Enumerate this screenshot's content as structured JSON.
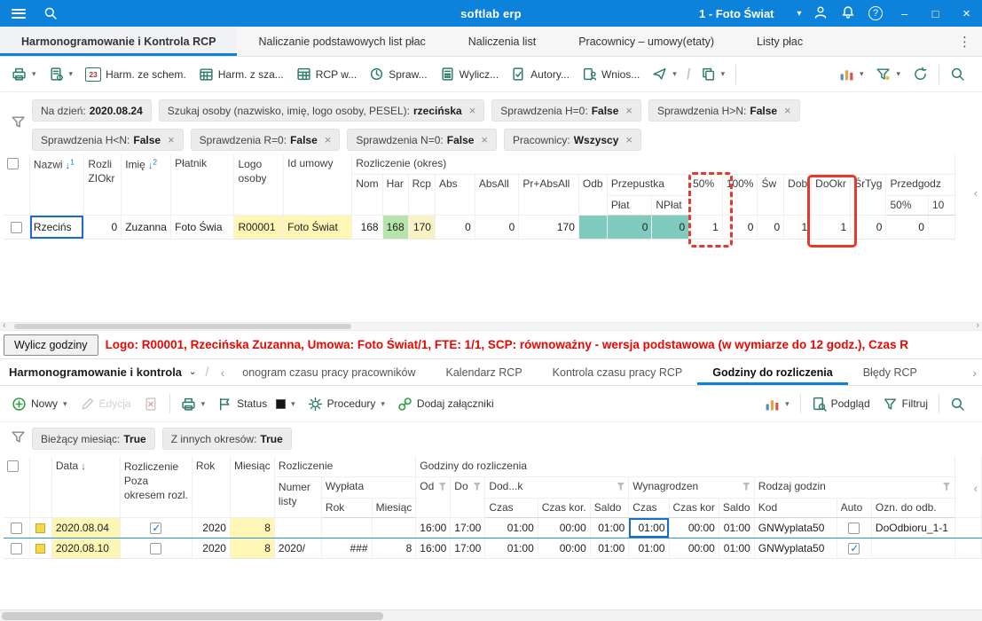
{
  "titlebar": {
    "app": "softlab erp",
    "company": "1 - Foto Świat"
  },
  "tabs": [
    {
      "label": "Harmonogramowanie i Kontrola RCP"
    },
    {
      "label": "Naliczanie podstawowych list płac"
    },
    {
      "label": "Naliczenia list"
    },
    {
      "label": "Pracownicy – umowy(etaty)"
    },
    {
      "label": "Listy płac"
    }
  ],
  "toolbar1": {
    "harm_ze_schem": "Harm. ze schem.",
    "harm_z_sza": "Harm. z sza...",
    "rcp_w": "RCP w...",
    "spraw": "Spraw...",
    "wylicz": "Wylicz...",
    "autory": "Autory...",
    "wnios": "Wnios..."
  },
  "filters1": [
    {
      "label": "Na dzień:",
      "value": "2020.08.24"
    },
    {
      "label": "Szukaj osoby (nazwisko, imię, logo osoby, PESEL):",
      "value": "rzecińska"
    },
    {
      "label": "Sprawdzenia  H=0:",
      "value": "False"
    },
    {
      "label": "Sprawdzenia  H>N:",
      "value": "False"
    },
    {
      "label": "Sprawdzenia  H<N:",
      "value": "False"
    },
    {
      "label": "Sprawdzenia  R=0:",
      "value": "False"
    },
    {
      "label": "Sprawdzenia  N=0:",
      "value": "False"
    },
    {
      "label": "Pracownicy:",
      "value": "Wszyscy"
    }
  ],
  "grid1": {
    "header": {
      "nazwisko": "Nazwi",
      "nazwisko_sort": "1",
      "rozli1": "Rozli",
      "rozli2": "ZIOkr",
      "imie": "Imię",
      "imie_sort": "2",
      "platnik": "Płatnik",
      "logo1": "Logo",
      "logo2": "osoby",
      "id_umowy": "Id umowy",
      "group": "Rozliczenie (okres)",
      "nom": "Nom",
      "har": "Har",
      "rcp": "Rcp",
      "abs": "Abs",
      "absall": "AbsAll",
      "prabsall": "Pr+AbsAll",
      "odb": "Odb",
      "przepustka": "Przepustka",
      "plat": "Płat",
      "nplat": "NPłat",
      "p50": "50%",
      "p100": "100%",
      "sw": "Św",
      "dob": "Dob",
      "dookr": "DoOkr",
      "srtyg": "ŚrTyg",
      "przedgodz": "Przedgodz",
      "pg50": "50%",
      "pg100": "10"
    },
    "row": {
      "nazwisko": "Rzecińs",
      "rozli": "0",
      "imie": "Zuzanna",
      "platnik": "Foto Świa",
      "logo": "R00001",
      "id_umowy": "Foto Świat",
      "nom": "168",
      "har": "168",
      "rcp": "170",
      "abs": "0",
      "absall": "0",
      "prabsall": "170",
      "odb": "",
      "plat": "0",
      "nplat": "0",
      "p50": "1",
      "p100": "0",
      "sw": "0",
      "dob": "1",
      "dookr": "1",
      "srtyg": "0",
      "pg50": "0",
      "pg100": ""
    }
  },
  "footer1": {
    "button": "Wylicz godziny",
    "info": "Logo: R00001, Rzecińska Zuzanna, Umowa: Foto Świat/1, FTE: 1/1, SCP: równoważny - wersja podstawowa (w wymiarze do 12 godz.), Czas R"
  },
  "section2": {
    "title": "Harmonogramowanie i kontrola",
    "tabs": [
      {
        "label": "onogram czasu pracy pracowników"
      },
      {
        "label": "Kalendarz RCP"
      },
      {
        "label": "Kontrola czasu pracy RCP"
      },
      {
        "label": "Godziny do rozliczenia"
      },
      {
        "label": "Błędy RCP"
      }
    ]
  },
  "toolbar2": {
    "nowy": "Nowy",
    "edycja": "Edycja",
    "status": "Status",
    "procedury": "Procedury",
    "zalaczniki": "Dodaj załączniki",
    "podglad": "Podgląd",
    "filtruj": "Filtruj"
  },
  "filters2": [
    {
      "label": "Bieżący miesiąc:",
      "value": "True"
    },
    {
      "label": "Z innych okresów:",
      "value": "True"
    }
  ],
  "grid2": {
    "header": {
      "data": "Data",
      "rozliczenie1": "Rozliczenie",
      "rozliczenie2": "Poza",
      "rozliczenie3": "okresem rozl.",
      "rok": "Rok",
      "miesiac": "Miesiąc",
      "rozliczenie_grp": "Rozliczenie",
      "godziny_grp": "Godziny do rozliczenia",
      "numer1": "Numer",
      "numer2": "listy",
      "wyplata": "Wypłata",
      "wyp_rok": "Rok",
      "wyp_miesiac": "Miesiąc",
      "od": "Od",
      "do": "Do",
      "dod": "Dod...k",
      "wynagrodzen": "Wynagrodzen",
      "rodzaj": "Rodzaj godzin",
      "czas": "Czas",
      "czas_kor": "Czas kor.",
      "saldo": "Saldo",
      "czas2": "Czas",
      "czas_kor2": "Czas kor",
      "saldo2": "Saldo",
      "kod": "Kod",
      "auto": "Auto",
      "ozn": "Ozn. do odb."
    },
    "rows": [
      {
        "data": "2020.08.04",
        "poza": true,
        "rok": "2020",
        "miesiac": "8",
        "numer": "",
        "wyp_rok": "",
        "wyp_mies": "",
        "od": "16:00",
        "do": "17:00",
        "dod_czas": "01:00",
        "dod_czas_kor": "00:00",
        "dod_saldo": "01:00",
        "wyn_czas": "01:00",
        "wyn_czas_kor": "00:00",
        "wyn_saldo": "01:00",
        "kod": "GNWyplata50",
        "auto": false,
        "ozn": "DoOdbioru_1-1"
      },
      {
        "data": "2020.08.10",
        "poza": false,
        "rok": "2020",
        "miesiac": "8",
        "numer": "2020/",
        "wyp_rok": "###",
        "wyp_mies": "8",
        "od": "16:00",
        "do": "17:00",
        "dod_czas": "01:00",
        "dod_czas_kor": "00:00",
        "dod_saldo": "01:00",
        "wyn_czas": "01:00",
        "wyn_czas_kor": "00:00",
        "wyn_saldo": "01:00",
        "kod": "GNWyplata50",
        "auto": true,
        "ozn": ""
      }
    ]
  },
  "colors": {
    "accent_blue": "#0d82da",
    "highlight_yellow": "#fdf6b4",
    "highlight_green": "#b7e3ac",
    "highlight_teal": "#7fccbf",
    "annotation_red": "#e43a2e",
    "info_red": "#eb0600"
  }
}
